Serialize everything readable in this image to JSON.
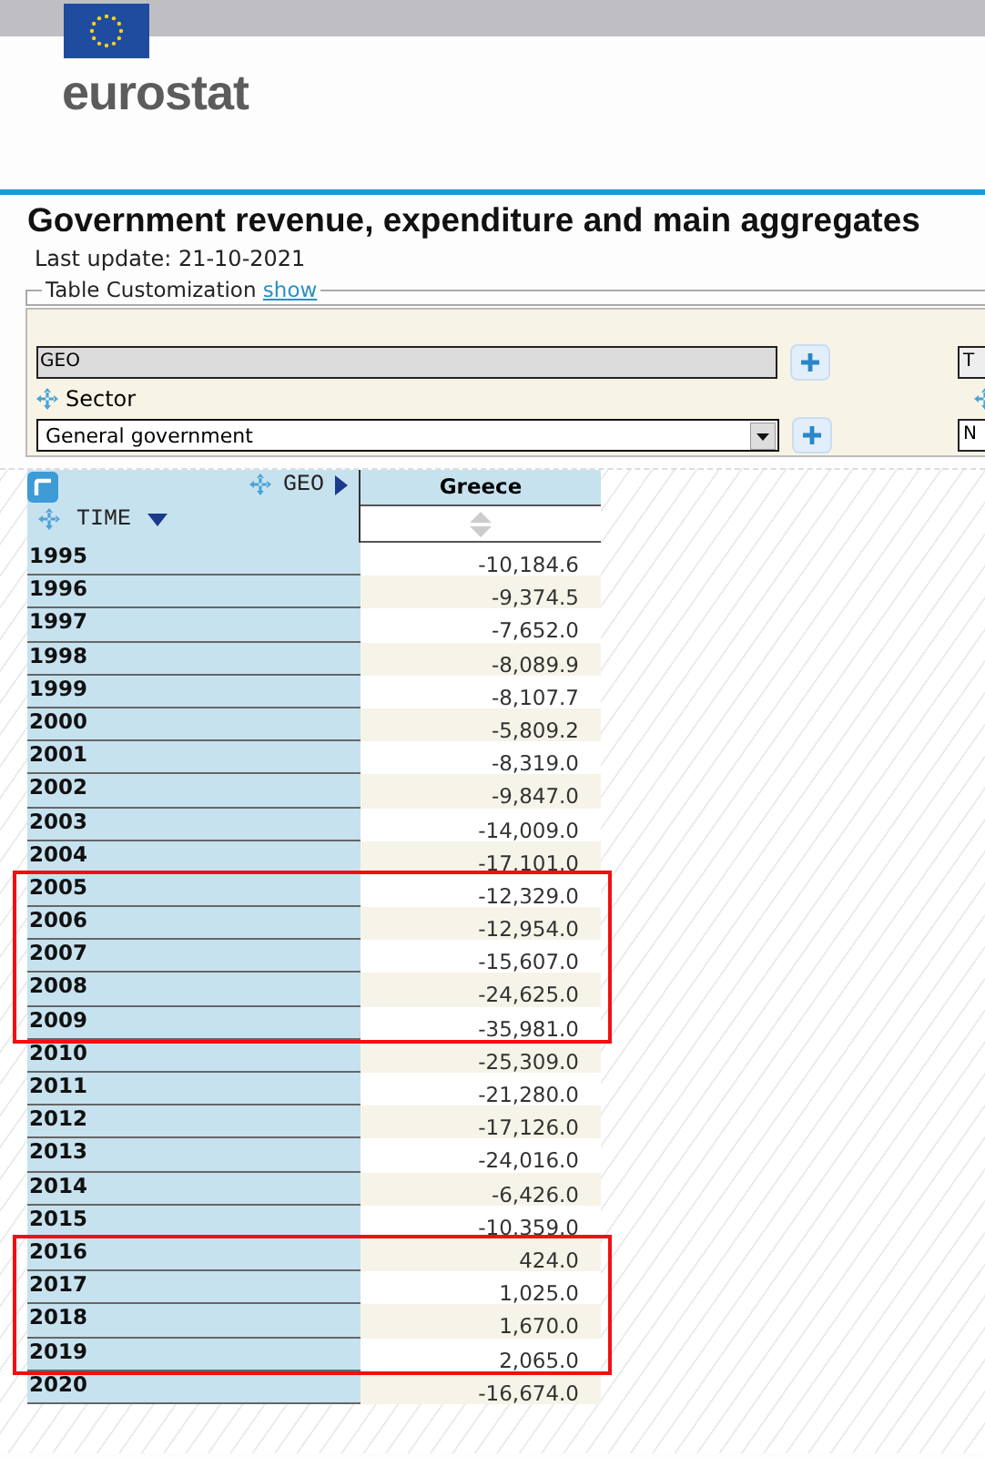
{
  "header": {
    "logo_text": "eurostat"
  },
  "page": {
    "title": "Government revenue, expenditure and main aggregates",
    "last_update": "Last update: 21-10-2021"
  },
  "customization": {
    "legend": "Table Customization",
    "link": "show",
    "expanded": false
  },
  "filters": {
    "geo_field": {
      "value": "GEO",
      "disabled": true
    },
    "sector_label": "Sector",
    "sector_select": {
      "value": "General government"
    },
    "right_field": {
      "value": "T"
    },
    "right_select": {
      "value": "N"
    }
  },
  "table": {
    "col_dimension": "GEO",
    "row_dimension": "TIME",
    "column": "Greece",
    "row_groups": [
      {
        "highlighted": false,
        "rows": [
          {
            "year": "1995",
            "value": "-10,184.6"
          },
          {
            "year": "1996",
            "value": "-9,374.5"
          },
          {
            "year": "1997",
            "value": "-7,652.0"
          },
          {
            "year": "1998",
            "value": "-8,089.9"
          },
          {
            "year": "1999",
            "value": "-8,107.7"
          },
          {
            "year": "2000",
            "value": "-5,809.2"
          },
          {
            "year": "2001",
            "value": "-8,319.0"
          },
          {
            "year": "2002",
            "value": "-9,847.0"
          },
          {
            "year": "2003",
            "value": "-14,009.0"
          },
          {
            "year": "2004",
            "value": "-17,101.0"
          }
        ]
      },
      {
        "highlighted": true,
        "rows": [
          {
            "year": "2005",
            "value": "-12,329.0"
          },
          {
            "year": "2006",
            "value": "-12,954.0"
          },
          {
            "year": "2007",
            "value": "-15,607.0"
          },
          {
            "year": "2008",
            "value": "-24,625.0"
          },
          {
            "year": "2009",
            "value": "-35,981.0"
          }
        ]
      },
      {
        "highlighted": false,
        "rows": [
          {
            "year": "2010",
            "value": "-25,309.0"
          },
          {
            "year": "2011",
            "value": "-21,280.0"
          },
          {
            "year": "2012",
            "value": "-17,126.0"
          },
          {
            "year": "2013",
            "value": "-24,016.0"
          },
          {
            "year": "2014",
            "value": "-6,426.0"
          },
          {
            "year": "2015",
            "value": "-10,359.0"
          }
        ]
      },
      {
        "highlighted": true,
        "rows": [
          {
            "year": "2016",
            "value": "424.0"
          },
          {
            "year": "2017",
            "value": "1,025.0"
          },
          {
            "year": "2018",
            "value": "1,670.0"
          },
          {
            "year": "2019",
            "value": "2,065.0"
          }
        ]
      },
      {
        "highlighted": false,
        "rows": [
          {
            "year": "2020",
            "value": "-16,674.0"
          }
        ]
      }
    ]
  }
}
